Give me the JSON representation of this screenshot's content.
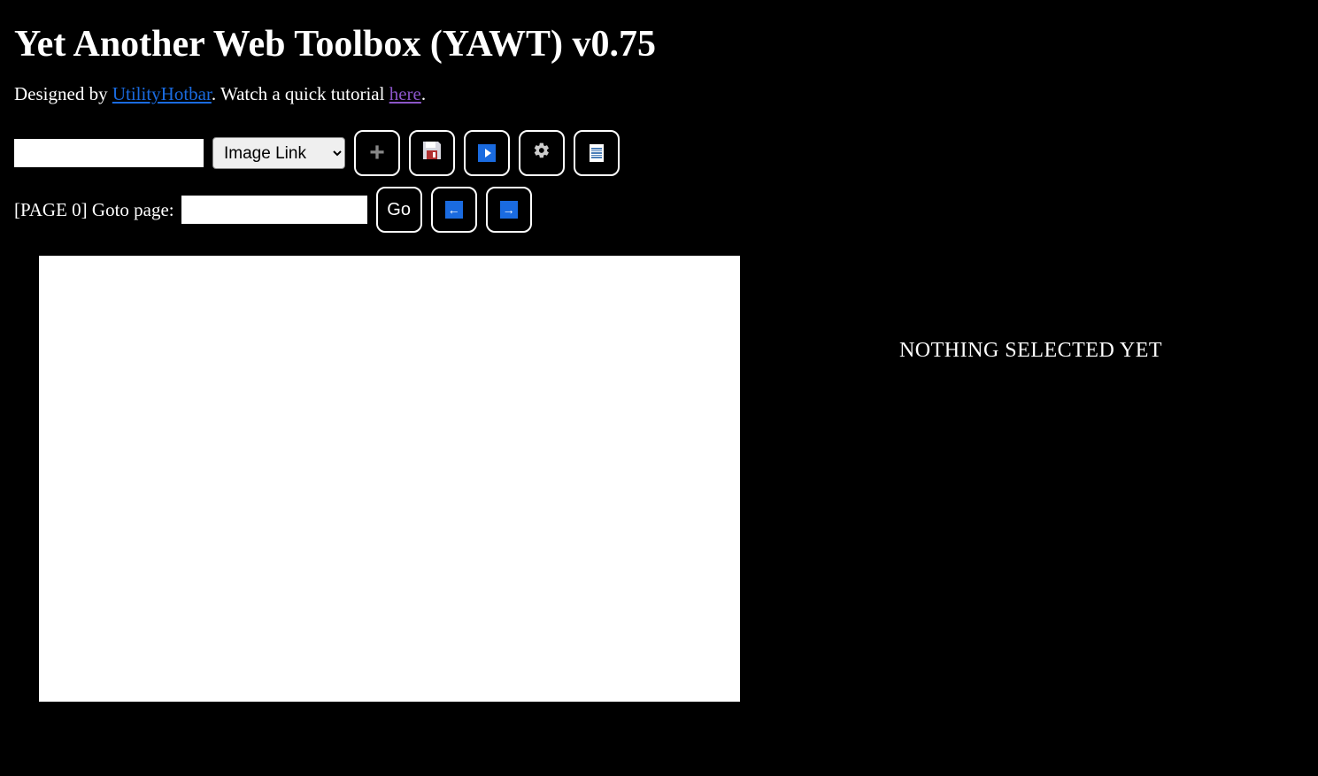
{
  "header": {
    "title": "Yet Another Web Toolbox (YAWT) v0.75",
    "designed_prefix": "Designed by ",
    "author_link_text": "UtilityHotbar",
    "middle_text": ". Watch a quick tutorial ",
    "tutorial_link_text": "here",
    "suffix": "."
  },
  "toolbar": {
    "url_input_value": "",
    "type_select_value": "Image Link",
    "add_label": "+",
    "go_label": "Go"
  },
  "paging": {
    "page_label_prefix": "[PAGE ",
    "page_number": "0",
    "page_label_suffix": "] Goto page:",
    "goto_value": ""
  },
  "sidepanel": {
    "empty_message": "NOTHING SELECTED YET"
  },
  "icons": {
    "left_arrow": "←",
    "right_arrow": "→"
  }
}
